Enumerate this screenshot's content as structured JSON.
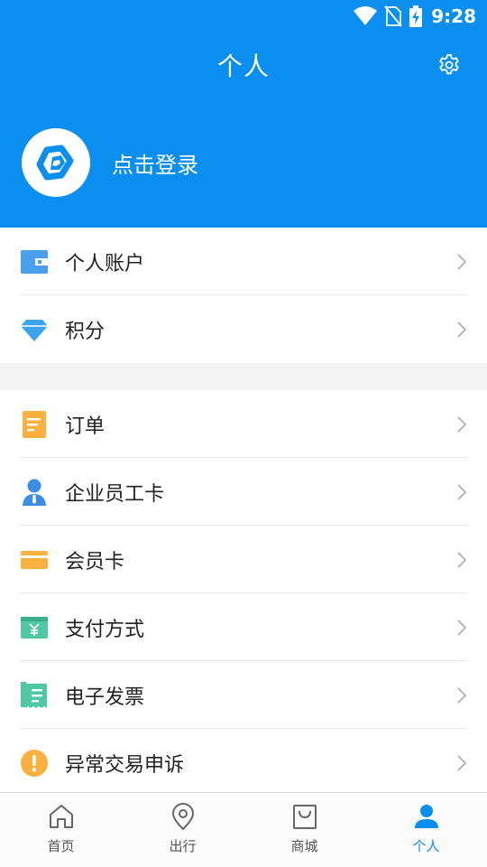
{
  "status_bar": {
    "time": "9:28"
  },
  "header": {
    "title": "个人",
    "login_text": "点击登录"
  },
  "group1": [
    {
      "label": "个人账户",
      "icon": "wallet-icon"
    },
    {
      "label": "积分",
      "icon": "diamond-icon"
    }
  ],
  "group2": [
    {
      "label": "订单",
      "icon": "order-icon"
    },
    {
      "label": "企业员工卡",
      "icon": "employee-icon"
    },
    {
      "label": "会员卡",
      "icon": "member-card-icon"
    },
    {
      "label": "支付方式",
      "icon": "payment-icon"
    },
    {
      "label": "电子发票",
      "icon": "invoice-icon"
    },
    {
      "label": "异常交易申诉",
      "icon": "alert-icon"
    }
  ],
  "tabs": [
    {
      "label": "首页",
      "icon": "home-icon"
    },
    {
      "label": "出行",
      "icon": "location-icon"
    },
    {
      "label": "商城",
      "icon": "shopping-bag-icon"
    },
    {
      "label": "个人",
      "icon": "person-icon",
      "active": true
    }
  ],
  "colors": {
    "primary": "#0a8ff0",
    "wallet": "#4a9ff0",
    "diamond": "#3ba4f0",
    "order": "#fbb040",
    "employee": "#3a8ee6",
    "member_card": "#fbb040",
    "payment": "#4fc9a4",
    "invoice": "#4fc9a4",
    "alert": "#fbb040"
  }
}
